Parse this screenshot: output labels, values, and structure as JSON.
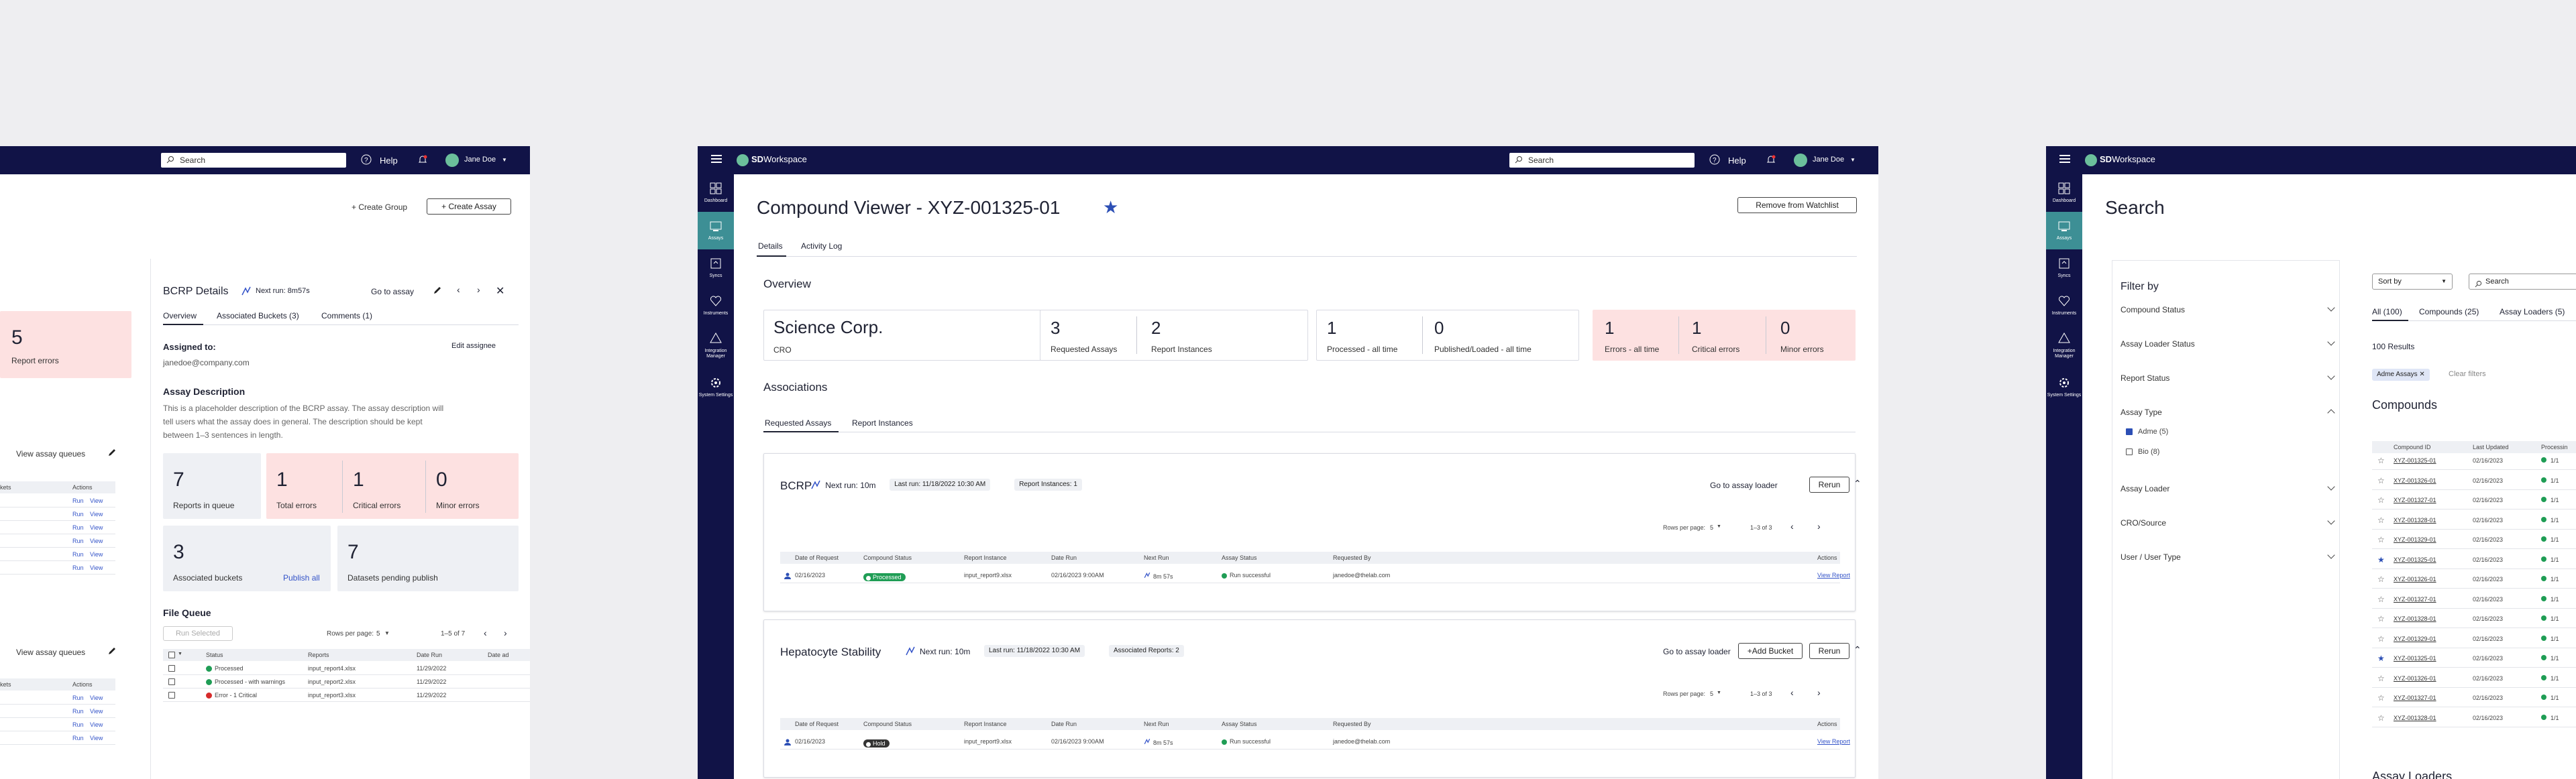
{
  "left": {
    "header": {
      "search_placeholder": "Search",
      "help": "Help",
      "user": "Jane Doe"
    },
    "actions": {
      "create_group": "+ Create Group",
      "create_assay": "+ Create Assay"
    },
    "partial_card": {
      "value": "5",
      "label": "Report errors"
    },
    "groups": [
      {
        "view_queues": "View assay queues",
        "col_a": "kets",
        "col_b": "Actions",
        "rows": [
          [
            "Run",
            "View"
          ],
          [
            "Run",
            "View"
          ],
          [
            "Run",
            "View"
          ],
          [
            "Run",
            "View"
          ],
          [
            "Run",
            "View"
          ],
          [
            "Run",
            "View"
          ]
        ]
      },
      {
        "view_queues": "View assay queues",
        "col_a": "kets",
        "col_b": "Actions",
        "rows": [
          [
            "Run",
            "View"
          ],
          [
            "Run",
            "View"
          ],
          [
            "Run",
            "View"
          ],
          [
            "Run",
            "View"
          ]
        ]
      }
    ],
    "details": {
      "title": "BCRP Details",
      "next_run": "Next run: 8m57s",
      "go_to_assay": "Go to assay",
      "tabs": [
        "Overview",
        "Associated Buckets (3)",
        "Comments (1)"
      ],
      "assigned_label": "Assigned to:",
      "edit_assignee": "Edit assignee",
      "assignee": "janedoe@company.com",
      "desc_title": "Assay Description",
      "desc_lines": [
        "This is a placeholder description of the BCRP assay. The assay description will",
        "tell users what the assay does in general. The description should be kept",
        "between 1–3 sentences in length."
      ],
      "stats": {
        "reports_in_queue": {
          "value": "7",
          "label": "Reports in queue"
        },
        "total_errors": {
          "value": "1",
          "label": "Total errors"
        },
        "critical_errors": {
          "value": "1",
          "label": "Critical errors"
        },
        "minor_errors": {
          "value": "0",
          "label": "Minor errors"
        },
        "associated_buckets": {
          "value": "3",
          "label": "Associated buckets"
        },
        "publish_all": "Publish all",
        "datasets_pending": {
          "value": "7",
          "label": "Datasets pending publish"
        }
      },
      "file_queue": {
        "title": "File Queue",
        "run_selected": "Run Selected",
        "rows_per_page": "Rows per page:",
        "rows_value": "5",
        "range": "1–5 of 7",
        "headers": [
          "Status",
          "Reports",
          "Date Run",
          "Date ad"
        ],
        "rows": [
          {
            "status": "Processed",
            "report": "input_report4.xlsx",
            "date": "11/29/2022",
            "color": "#1f9d55"
          },
          {
            "status": "Processed - with warnings",
            "report": "input_report2.xlsx",
            "date": "11/29/2022",
            "color": "#1f9d55"
          },
          {
            "status": "Error - 1 Critical",
            "report": "input_report3.xlsx",
            "date": "11/29/2022",
            "color": "#d62b2b"
          }
        ]
      }
    }
  },
  "middle": {
    "header": {
      "brand_a": "SD",
      "brand_b": "Workspace",
      "search_placeholder": "Search",
      "help": "Help",
      "user": "Jane Doe"
    },
    "sidebar": [
      "Dashboard",
      "Assays",
      "Syncs",
      "Instruments",
      "Integration Manager",
      "System Settings"
    ],
    "title": "Compound Viewer - XYZ-001325-01",
    "remove_watchlist": "Remove from Watchlist",
    "tabs": [
      "Details",
      "Activity Log"
    ],
    "overview_title": "Overview",
    "company": {
      "name": "Science Corp.",
      "type": "CRO"
    },
    "stats": [
      {
        "value": "3",
        "label": "Requested Assays"
      },
      {
        "value": "2",
        "label": "Report Instances"
      },
      {
        "value": "1",
        "label": "Processed - all time"
      },
      {
        "value": "0",
        "label": "Published/Loaded - all time"
      },
      {
        "value": "1",
        "label": "Errors - all time"
      },
      {
        "value": "1",
        "label": "Critical errors"
      },
      {
        "value": "0",
        "label": "Minor errors"
      }
    ],
    "associations_title": "Associations",
    "assoc_tabs": [
      "Requested Assays",
      "Report Instances"
    ],
    "assays": [
      {
        "name": "BCRP",
        "next_run": "Next run: 10m",
        "last_run": "Last run: 11/18/2022 10:30 AM",
        "extra": "Report Instances: 1",
        "go_loader": "Go to assay loader",
        "add_bucket": "",
        "rerun": "Rerun",
        "rows_per_page": "Rows per page:",
        "rows_value": "5",
        "range": "1–3 of 3",
        "headers": [
          "Date of Request",
          "Compound Status",
          "Report Instance",
          "Date Run",
          "Next Run",
          "Assay Status",
          "Requested By",
          "Actions"
        ],
        "rows": [
          {
            "date": "02/16/2023",
            "status": "Processed",
            "report": "input_report9.xlsx",
            "date_run": "02/16/2023 9:00AM",
            "next_run": "8m 57s",
            "assay_status": "Run successful",
            "requested_by": "janedoe@thelab.com",
            "action": "View Report"
          }
        ]
      },
      {
        "name": "Hepatocyte Stability",
        "next_run": "Next run: 10m",
        "last_run": "Last run: 11/18/2022 10:30 AM",
        "extra": "Associated Reports: 2",
        "go_loader": "Go to assay loader",
        "add_bucket": "+Add Bucket",
        "rerun": "Rerun",
        "rows_per_page": "Rows per page:",
        "rows_value": "5",
        "range": "1–3 of 3",
        "headers": [
          "Date of Request",
          "Compound Status",
          "Report Instance",
          "Date Run",
          "Next Run",
          "Assay Status",
          "Requested By",
          "Actions"
        ],
        "rows": [
          {
            "date": "02/16/2023",
            "status": "Hold",
            "report": "input_report9.xlsx",
            "date_run": "02/16/2023 9:00AM",
            "next_run": "8m 57s",
            "assay_status": "Run successful",
            "requested_by": "janedoe@thelab.com",
            "action": "View Report"
          }
        ]
      }
    ]
  },
  "right": {
    "header": {
      "brand_a": "SD",
      "brand_b": "Workspace",
      "search_placeholder": "Search",
      "help": "Help",
      "user": "Jane Doe"
    },
    "sidebar": [
      "Dashboard",
      "Assays",
      "Syncs",
      "Instruments",
      "Integration Manager",
      "System Settings"
    ],
    "title": "Search",
    "filter_by": "Filter by",
    "filters": [
      "Compound Status",
      "Assay Loader Status",
      "Report Status",
      "Assay Type",
      "Assay Loader",
      "CRO/Source",
      "User / User Type"
    ],
    "assay_type_options": [
      {
        "label": "Adme (5)",
        "checked": true
      },
      {
        "label": "Bio (8)",
        "checked": false
      }
    ],
    "sort_by": "Sort by",
    "search_placeholder": "Search",
    "result_tabs": [
      "All (100)",
      "Compounds (25)",
      "Assay Loaders (5)"
    ],
    "results_count": "100 Results",
    "chip": "Adme Assays",
    "clear_filters": "Clear filters",
    "compounds_title": "Compounds",
    "headers": [
      "Compound ID",
      "Last Updated",
      "Processin"
    ],
    "rows": [
      {
        "id": "XYZ-001325-01",
        "date": "02/16/2023",
        "star": false,
        "ratio": "1/1"
      },
      {
        "id": "XYZ-001326-01",
        "date": "02/16/2023",
        "star": false,
        "ratio": "1/1"
      },
      {
        "id": "XYZ-001327-01",
        "date": "02/16/2023",
        "star": false,
        "ratio": "1/1"
      },
      {
        "id": "XYZ-001328-01",
        "date": "02/16/2023",
        "star": false,
        "ratio": "1/1"
      },
      {
        "id": "XYZ-001329-01",
        "date": "02/16/2023",
        "star": false,
        "ratio": "1/1"
      },
      {
        "id": "XYZ-001325-01",
        "date": "02/16/2023",
        "star": true,
        "ratio": "1/1"
      },
      {
        "id": "XYZ-001326-01",
        "date": "02/16/2023",
        "star": false,
        "ratio": "1/1"
      },
      {
        "id": "XYZ-001327-01",
        "date": "02/16/2023",
        "star": false,
        "ratio": "1/1"
      },
      {
        "id": "XYZ-001328-01",
        "date": "02/16/2023",
        "star": false,
        "ratio": "1/1"
      },
      {
        "id": "XYZ-001329-01",
        "date": "02/16/2023",
        "star": false,
        "ratio": "1/1"
      },
      {
        "id": "XYZ-001325-01",
        "date": "02/16/2023",
        "star": true,
        "ratio": "1/1"
      },
      {
        "id": "XYZ-001326-01",
        "date": "02/16/2023",
        "star": false,
        "ratio": "1/1"
      },
      {
        "id": "XYZ-001327-01",
        "date": "02/16/2023",
        "star": false,
        "ratio": "1/1"
      },
      {
        "id": "XYZ-001328-01",
        "date": "02/16/2023",
        "star": false,
        "ratio": "1/1"
      }
    ],
    "assay_loaders_title": "Assay Loaders"
  },
  "colors": {
    "nav": "#111347",
    "accent": "#3d8f95",
    "error_bg": "#fde1e1",
    "success": "#1f9d55",
    "link": "#3353c8",
    "star": "#2c4fb5"
  }
}
